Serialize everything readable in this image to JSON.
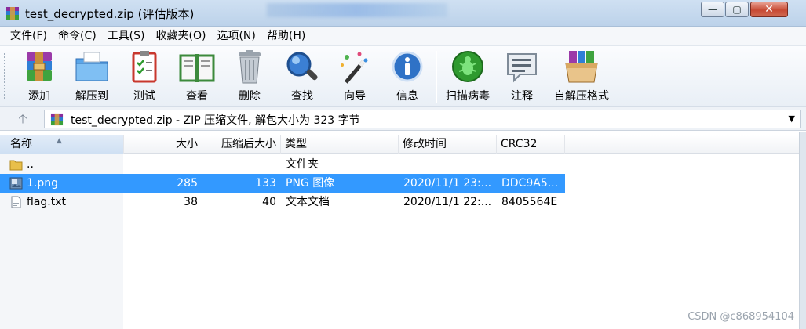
{
  "window": {
    "title": "test_decrypted.zip (评估版本)",
    "controls": {
      "minimize": "—",
      "maximize": "▢",
      "close": "✕"
    }
  },
  "menu": [
    "文件(F)",
    "命令(C)",
    "工具(S)",
    "收藏夹(O)",
    "选项(N)",
    "帮助(H)"
  ],
  "toolbar": [
    {
      "label": "添加",
      "icon": "add-archive-icon"
    },
    {
      "label": "解压到",
      "icon": "extract-to-icon"
    },
    {
      "label": "测试",
      "icon": "test-icon"
    },
    {
      "label": "查看",
      "icon": "view-book-icon"
    },
    {
      "label": "删除",
      "icon": "trash-icon"
    },
    {
      "label": "查找",
      "icon": "find-icon"
    },
    {
      "label": "向导",
      "icon": "wizard-icon"
    },
    {
      "label": "信息",
      "icon": "info-icon"
    },
    {
      "label": "扫描病毒",
      "icon": "virus-scan-icon"
    },
    {
      "label": "注释",
      "icon": "comment-icon"
    },
    {
      "label": "自解压格式",
      "icon": "sfx-icon"
    }
  ],
  "address": {
    "up_label": "🡡",
    "path": "test_decrypted.zip - ZIP 压缩文件, 解包大小为 323 字节",
    "dropdown": "▼"
  },
  "columns": [
    "名称",
    "大小",
    "压缩后大小",
    "类型",
    "修改时间",
    "CRC32"
  ],
  "files": [
    {
      "name": "..",
      "size": "",
      "packed": "",
      "type": "文件夹",
      "modified": "",
      "crc": "",
      "icon": "folder-icon",
      "selected": false
    },
    {
      "name": "1.png",
      "size": "285",
      "packed": "133",
      "type": "PNG 图像",
      "modified": "2020/11/1 23:...",
      "crc": "DDC9A5...",
      "icon": "image-file-icon",
      "selected": true
    },
    {
      "name": "flag.txt",
      "size": "38",
      "packed": "40",
      "type": "文本文档",
      "modified": "2020/11/1 22:...",
      "crc": "8405564E",
      "icon": "text-file-icon",
      "selected": false
    }
  ],
  "watermark": "CSDN @c868954104",
  "colors": {
    "selection": "#3399ff",
    "titlebar": "#c6daf0",
    "close_button": "#c74a34"
  }
}
